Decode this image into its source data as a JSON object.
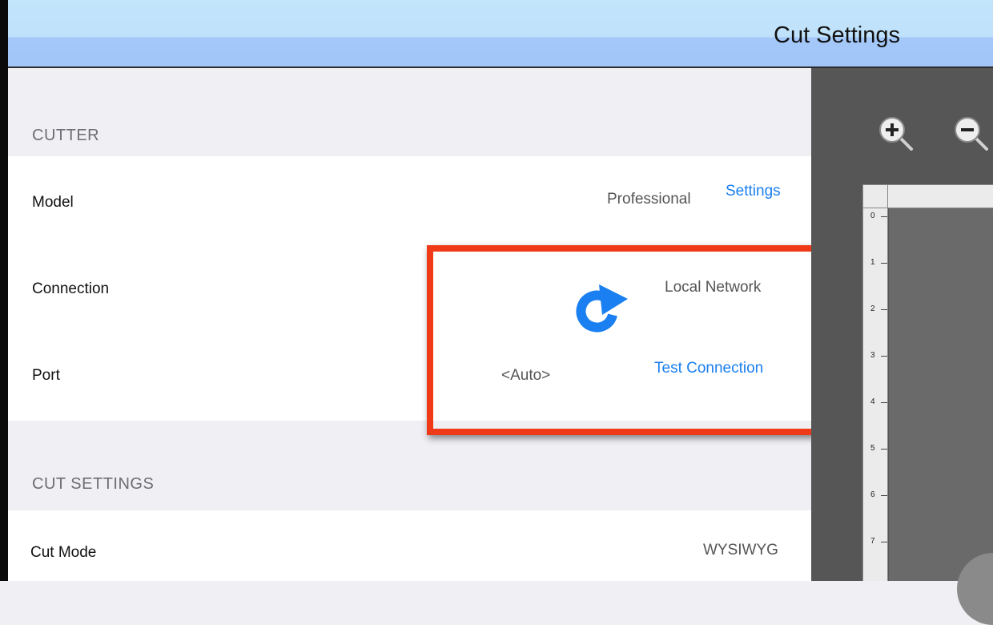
{
  "title": "Cut Settings",
  "cutter": {
    "header": "CUTTER",
    "model": {
      "label": "Model",
      "value": "Professional",
      "action": "Settings"
    },
    "connection": {
      "label": "Connection",
      "value": "Local Network"
    },
    "port": {
      "label": "Port",
      "value": "<Auto>",
      "action": "Test Connection"
    }
  },
  "cut_settings": {
    "header": "CUT SETTINGS",
    "cut_mode": {
      "label": "Cut Mode",
      "value": "WYSIWYG"
    }
  },
  "canvas": {
    "ruler_ticks": [
      "0",
      "1",
      "2",
      "3",
      "4",
      "5",
      "6",
      "7"
    ]
  },
  "colors": {
    "accent": "#1a7ff0",
    "highlight": "#f03a17"
  }
}
